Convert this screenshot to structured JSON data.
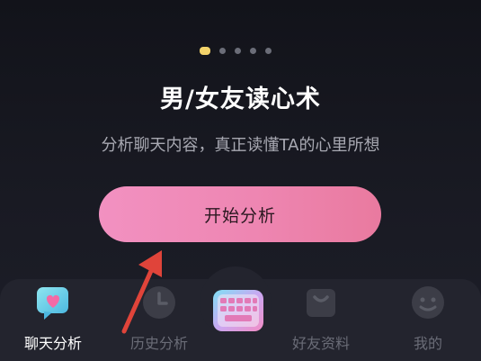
{
  "carousel": {
    "total_pages": 5,
    "active_page": 1
  },
  "hero": {
    "title": "男/女友读心术",
    "subtitle": "分析聊天内容，真正读懂TA的心里所想",
    "button_label": "开始分析"
  },
  "tabbar": {
    "tabs": [
      {
        "label": "聊天分析",
        "icon": "chat-bubble-heart-icon",
        "active": true
      },
      {
        "label": "历史分析",
        "icon": "clock-icon",
        "active": false
      },
      {
        "label": "",
        "icon": "keyboard-icon",
        "active": false
      },
      {
        "label": "好友资料",
        "icon": "bag-icon",
        "active": false
      },
      {
        "label": "我的",
        "icon": "smiley-face-icon",
        "active": false
      }
    ]
  },
  "colors": {
    "background": "#16171f",
    "button_gradient_start": "#f291c1",
    "button_gradient_end": "#e97a9f",
    "active_dot": "#f3d36a",
    "arrow": "#e0443a",
    "tabbar": "#23242e"
  }
}
